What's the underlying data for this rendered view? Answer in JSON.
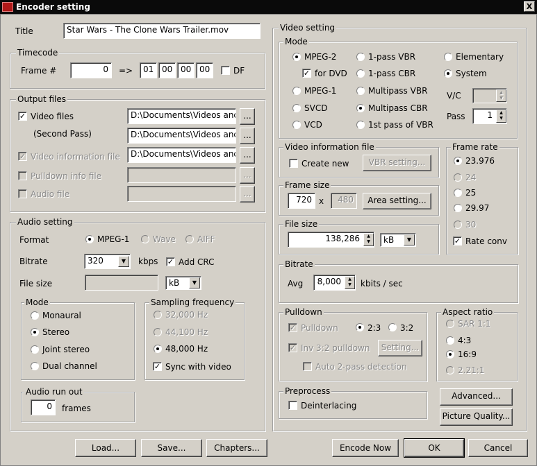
{
  "window": {
    "title": "Encoder setting",
    "close_label": "X"
  },
  "title_field": {
    "label": "Title",
    "value": "Star Wars - The Clone Wars Trailer.mov"
  },
  "timecode": {
    "legend": "Timecode",
    "frame_label": "Frame #",
    "frame_value": "0",
    "arrow": "=>",
    "tc": [
      "01",
      "00",
      "00",
      "00"
    ],
    "df_label": "DF",
    "df_checked": false
  },
  "output_files": {
    "legend": "Output files",
    "video_files_label": "Video files",
    "second_pass_label": "(Second Pass)",
    "video_info_label": "Video information file",
    "pulldown_info_label": "Pulldown info file",
    "audio_file_label": "Audio file",
    "path1": "D:\\Documents\\Videos and",
    "path2": "D:\\Documents\\Videos and",
    "path3": "D:\\Documents\\Videos and",
    "browse_label": "..."
  },
  "audio": {
    "legend": "Audio setting",
    "format_label": "Format",
    "format_options": [
      "MPEG-1",
      "Wave",
      "AIFF"
    ],
    "format_selected": "MPEG-1",
    "bitrate_label": "Bitrate",
    "bitrate_value": "320",
    "bitrate_unit": "kbps",
    "add_crc_label": "Add CRC",
    "filesize_label": "File size",
    "filesize_unit": "kB",
    "mode_legend": "Mode",
    "modes": [
      "Monaural",
      "Stereo",
      "Joint stereo",
      "Dual channel"
    ],
    "mode_selected": "Stereo",
    "sf_legend": "Sampling frequency",
    "sf_options": [
      "32,000 Hz",
      "44,100 Hz",
      "48,000 Hz"
    ],
    "sf_selected": "48,000 Hz",
    "sync_label": "Sync with video",
    "runout_legend": "Audio run out",
    "runout_value": "0",
    "runout_unit": "frames"
  },
  "video": {
    "legend": "Video setting",
    "mode_legend": "Mode",
    "mode_col1": [
      "MPEG-2",
      "MPEG-1",
      "SVCD",
      "VCD"
    ],
    "for_dvd_label": "for DVD",
    "mode_col2": [
      "1-pass VBR",
      "1-pass CBR",
      "Multipass VBR",
      "Multipass CBR",
      "1st pass of VBR"
    ],
    "mode_col3": [
      "Elementary",
      "System"
    ],
    "vc_label": "V/C",
    "pass_label": "Pass",
    "pass_value": "1",
    "vinfo_legend": "Video information file",
    "create_new_label": "Create new",
    "vbr_setting_label": "VBR setting...",
    "framesize_legend": "Frame size",
    "width": "720",
    "x": "x",
    "height": "480",
    "area_setting_label": "Area setting...",
    "filesize_legend": "File size",
    "filesize_value": "138,286",
    "filesize_unit": "kB",
    "framerate_legend": "Frame rate",
    "framerates": [
      "23.976",
      "24",
      "25",
      "29.97",
      "30"
    ],
    "framerate_selected": "23.976",
    "rate_conv_label": "Rate conv",
    "bitrate_legend": "Bitrate",
    "avg_label": "Avg",
    "avg_value": "8,000",
    "avg_unit": "kbits / sec",
    "pulldown_legend": "Pulldown",
    "pulldown_label": "Pulldown",
    "p23": "2:3",
    "p32": "3:2",
    "inv_label": "Inv 3:2 pulldown",
    "setting_label": "Setting...",
    "auto2_label": "Auto 2-pass detection",
    "aspect_legend": "Aspect ratio",
    "aspects": [
      "SAR 1:1",
      "4:3",
      "16:9",
      "2.21:1"
    ],
    "aspect_selected": "16:9",
    "preprocess_legend": "Preprocess",
    "deinterlacing_label": "Deinterlacing",
    "advanced_label": "Advanced...",
    "picture_quality_label": "Picture Quality..."
  },
  "bottom": {
    "load": "Load...",
    "save": "Save...",
    "chapters": "Chapters...",
    "encode_now": "Encode Now",
    "ok": "OK",
    "cancel": "Cancel"
  }
}
